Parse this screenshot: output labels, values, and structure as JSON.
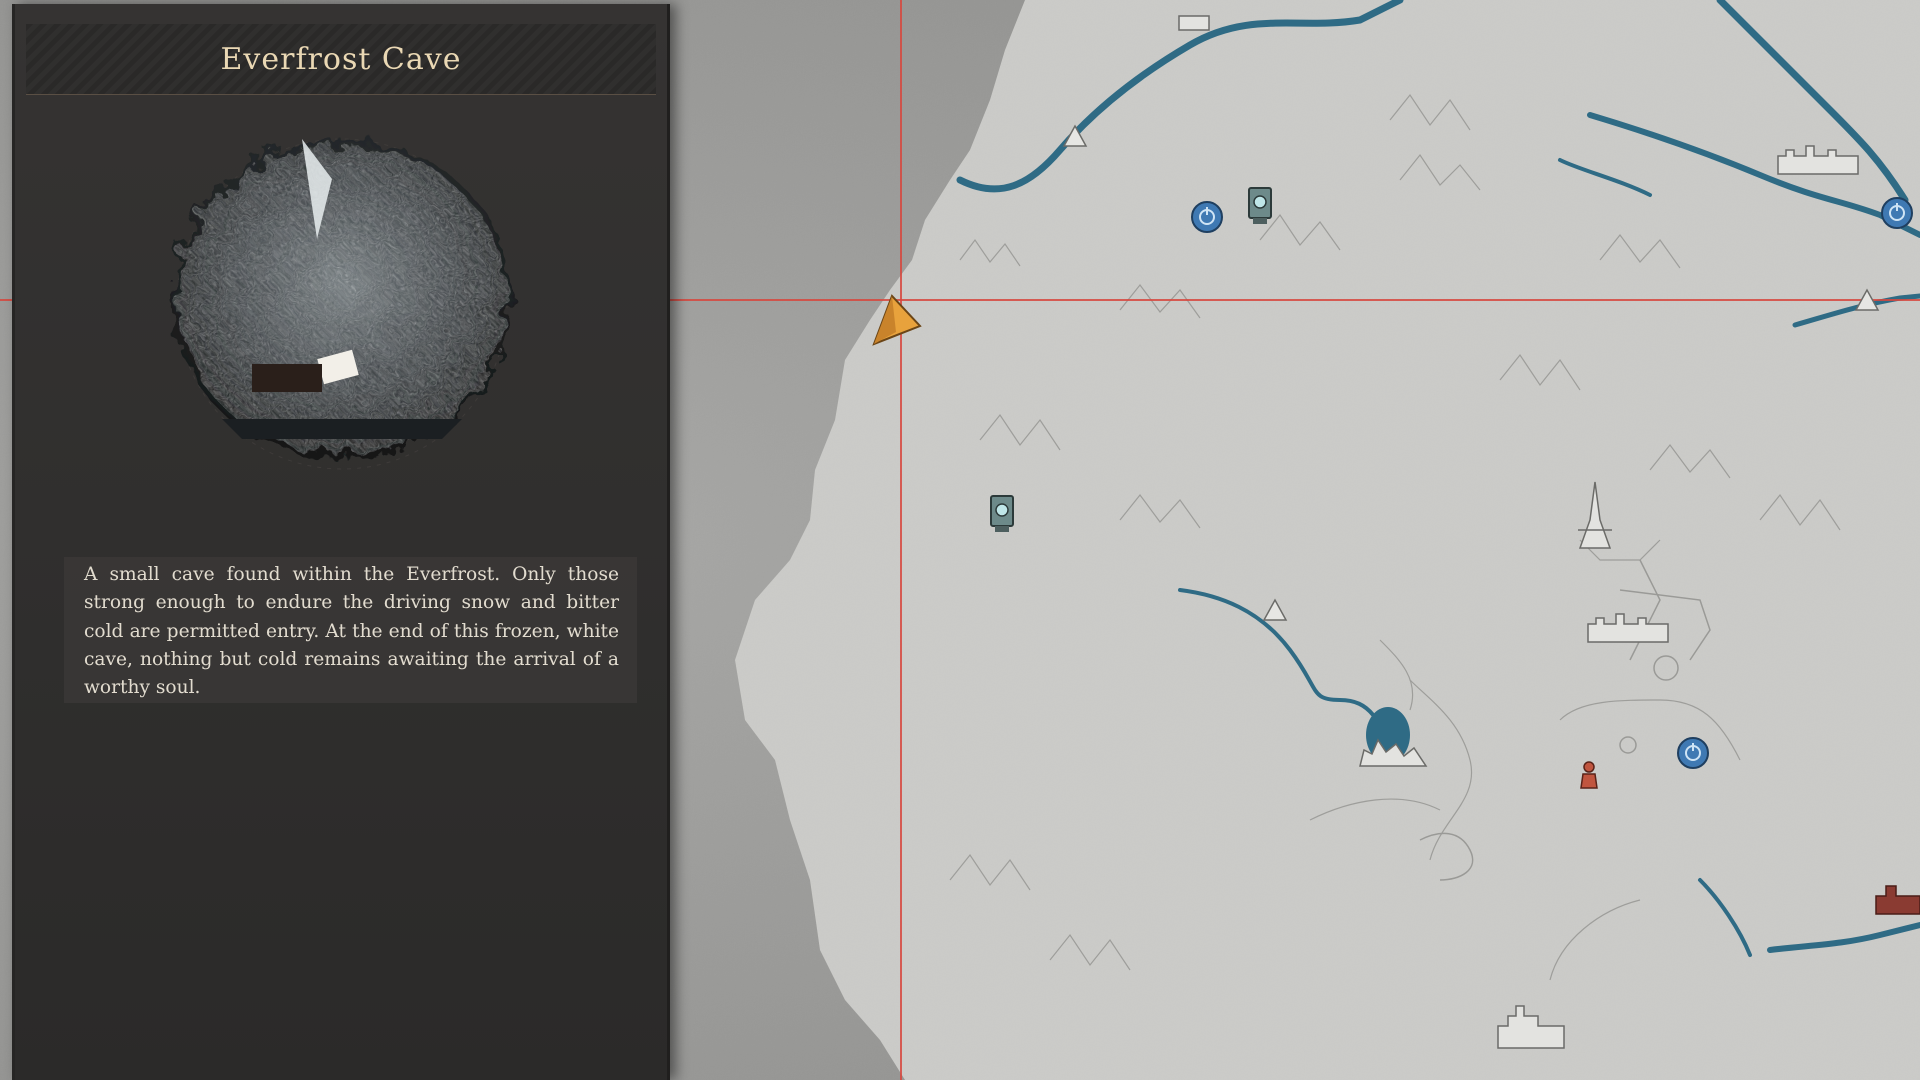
{
  "location": {
    "title": "Everfrost Cave",
    "description": "A small cave found within the Everfrost. Only those strong enough to endure the driving snow and bitter cold are permitted entry. At the end of this frozen, white cave, nothing but cold remains awaiting the arrival of a worthy soul."
  },
  "colors": {
    "map_paper": "#c9c9c6",
    "sea": "#9c9c9a",
    "river": "#2f6b85",
    "crosshair": "#d7463d",
    "player_arrow": "#e8a23c",
    "waypoint": "#3f79b3",
    "title_text": "#ead8b4"
  },
  "map_icons": [
    "player-arrow-icon",
    "waypoint-icon",
    "waystone-icon",
    "camp-icon",
    "tower-icon",
    "castle-icon",
    "npc-figure-icon",
    "ruin-icon"
  ]
}
